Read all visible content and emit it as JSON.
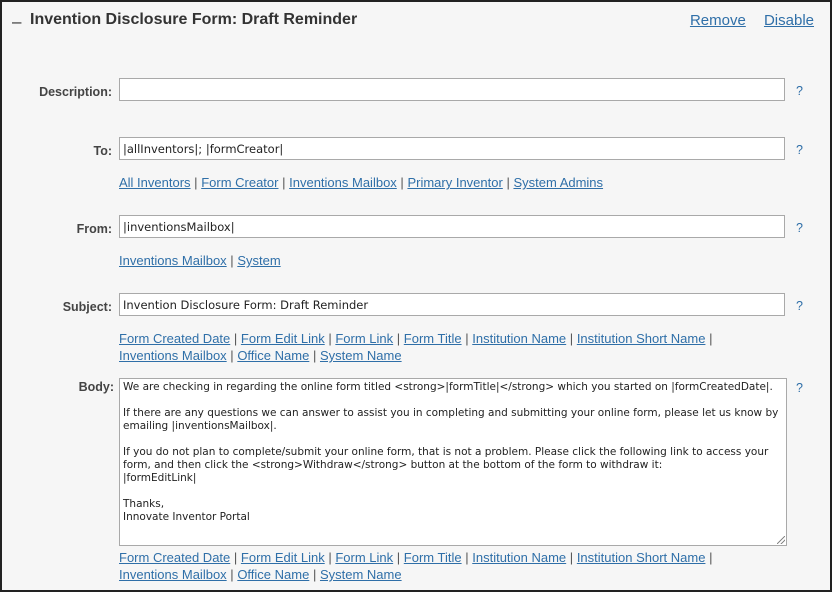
{
  "header": {
    "toggle": "–",
    "title": "Invention Disclosure Form: Draft Reminder",
    "remove_label": "Remove",
    "disable_label": "Disable"
  },
  "help_label": "?",
  "separator": "|",
  "description": {
    "label": "Description:",
    "value": ""
  },
  "to": {
    "label": "To:",
    "value": "|allInventors|; |formCreator|",
    "links": [
      "All Inventors",
      "Form Creator",
      "Inventions Mailbox",
      "Primary Inventor",
      "System Admins"
    ]
  },
  "from": {
    "label": "From:",
    "value": "|inventionsMailbox|",
    "links": [
      "Inventions Mailbox",
      "System"
    ]
  },
  "subject": {
    "label": "Subject:",
    "value": "Invention Disclosure Form: Draft Reminder",
    "links": [
      "Form Created Date",
      "Form Edit Link",
      "Form Link",
      "Form Title",
      "Institution Name",
      "Institution Short Name",
      "Inventions Mailbox",
      "Office Name",
      "System Name"
    ]
  },
  "body": {
    "label": "Body:",
    "paragraphs": [
      "We are checking in regarding the online form titled <strong>|formTitle|</strong> which you started on |formCreatedDate|.",
      "If there are any questions we can answer to assist you in completing and submitting your online form, please let us know by emailing |inventionsMailbox|.",
      "If you do not plan to complete/submit your online form, that is not a problem. Please click the following link to access your form, and then click the <strong>Withdraw</strong> button at the bottom of the form to withdraw it:\n|formEditLink|",
      "Thanks,\nInnovate Inventor Portal"
    ],
    "links": [
      "Form Created Date",
      "Form Edit Link",
      "Form Link",
      "Form Title",
      "Institution Name",
      "Institution Short Name",
      "Inventions Mailbox",
      "Office Name",
      "System Name"
    ]
  }
}
